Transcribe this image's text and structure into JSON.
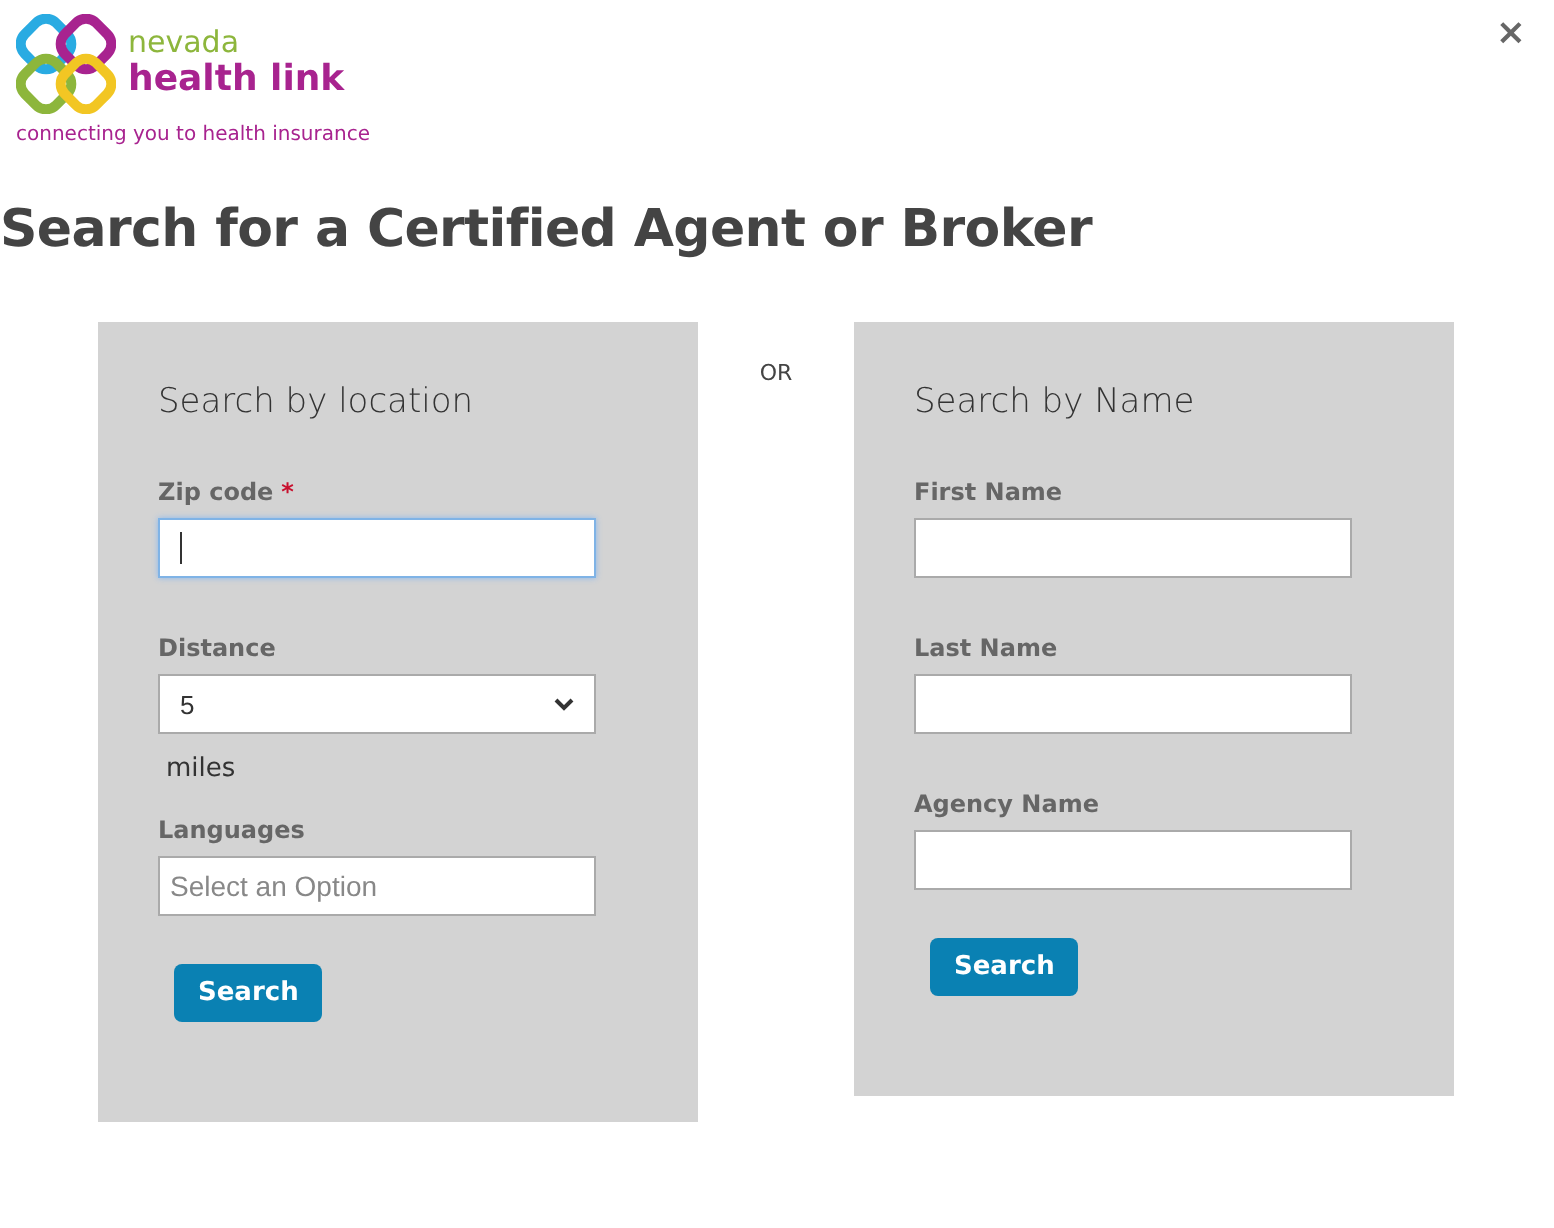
{
  "logo": {
    "line_1": "nevada",
    "line_2": "health link",
    "tagline": "connecting you to health insurance"
  },
  "close": "×",
  "title": "Search for a Certified Agent or Broker",
  "separator": "OR",
  "panels": [
    {
      "heading": "Search by location",
      "fields": [
        {
          "kind": "text",
          "label": "Zip code",
          "required_mark": "*",
          "focused": true
        },
        {
          "kind": "select",
          "label": "Distance",
          "value": "5",
          "suffix": "miles",
          "focused": false
        },
        {
          "kind": "multiselect",
          "label": "Languages",
          "placeholder": "Select an Option",
          "focused": false
        }
      ],
      "button": "Search"
    },
    {
      "heading": "Search by Name",
      "fields": [
        {
          "kind": "text",
          "label": "First Name",
          "focused": false
        },
        {
          "kind": "text",
          "label": "Last Name",
          "focused": false
        },
        {
          "kind": "text",
          "label": "Agency Name",
          "focused": false
        }
      ],
      "button": "Search"
    }
  ]
}
